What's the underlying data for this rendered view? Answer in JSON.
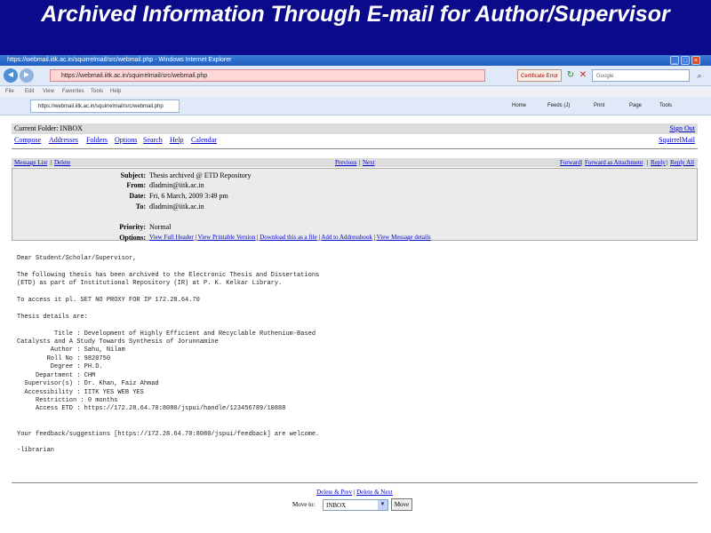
{
  "slide": {
    "title": "Archived Information Through E-mail for Author/Supervisor"
  },
  "browser": {
    "window_title": "https://webmail.iitk.ac.in/squirrelmail/src/webmail.php - Windows Internet Explorer",
    "minimize_glyph": "_",
    "maximize_glyph": "□",
    "close_glyph": "×",
    "back_glyph": "◄",
    "forward_glyph": "►",
    "address": "https://webmail.iitk.ac.in/squirrelmail/src/webmail.php",
    "cert_error": "Certificate Error",
    "refresh_glyph": "↻",
    "stop_glyph": "✕",
    "search_placeholder": "Google",
    "search_glyph": "⌕",
    "menu": [
      "File",
      "Edit",
      "View",
      "Favorites",
      "Tools",
      "Help"
    ],
    "tab_title": "https://webmail.iitk.ac.in/squirrelmail/src/webmail.php",
    "toolbar": {
      "home": "Home",
      "feeds": "Feeds (J)",
      "print": "Print",
      "page": "Page",
      "tools": "Tools"
    }
  },
  "mail": {
    "current_folder": "Current Folder: INBOX",
    "sign_out": "Sign Out",
    "nav": [
      "Compose",
      "Addresses",
      "Folders",
      "Options",
      "Search",
      "Help",
      "Calendar"
    ],
    "brand_link": "SquirrelMail",
    "toolbar": {
      "message_list": "Message List",
      "delete": "Delete",
      "previous": "Previous",
      "next": "Next",
      "forward": "Forward",
      "forward_attachment": "Forward as Attachment",
      "reply": "Reply",
      "reply_all": "Reply All"
    },
    "header": {
      "subject_label": "Subject:",
      "subject": "Thesis archived @ ETD Repository",
      "from_label": "From:",
      "from": "dladmin@iitk.ac.in",
      "date_label": "Date:",
      "date": "Fri, 6 March, 2009 3:49 pm",
      "to_label": "To:",
      "to": "dladmin@iitk.ac.in",
      "priority_label": "Priority:",
      "priority": "Normal",
      "options_label": "Options:",
      "options": [
        "View Full Header",
        "View Printable Version",
        "Download this as a file",
        "Add to Addressbook",
        "View Message details"
      ]
    },
    "body": "Dear Student/Scholar/Supervisor,\n\nThe following thesis has been archived to the Electronic Thesis and Dissertations\n(ETD) as part of Institutional Repository (IR) at P. K. Kelkar Library.\n\nTo access it pl. SET NO PROXY FOR IP 172.28.64.70\n\nThesis details are:\n\n          Title : Development of Highly Efficient and Recyclable Ruthenium-Based\nCatalysts and A Study Towards Synthesis of Jorunnamine\n         Author : Sahu, Nilam\n        Roll No : 9820750\n         Degree : PH.D.\n     Department : CHM\n  Supervisor(s) : Dr. Khan, Faiz Ahmad\n  Accessibility : IITK YES WEB YES\n     Restriction : 0 months\n     Access ETD : https://172.28.64.70:8080/jspui/handle/123456789/10888\n\n\nYour feedback/suggestions [https://172.28.64.70:8080/jspui/feedback] are welcome.\n\n-librarian",
    "footer": {
      "delete_prev": "Delete & Prev",
      "delete_next": "Delete & Next"
    },
    "move": {
      "label": "Move to:",
      "selected": "INBOX",
      "button": "Move",
      "arrow_glyph": "▼"
    }
  }
}
